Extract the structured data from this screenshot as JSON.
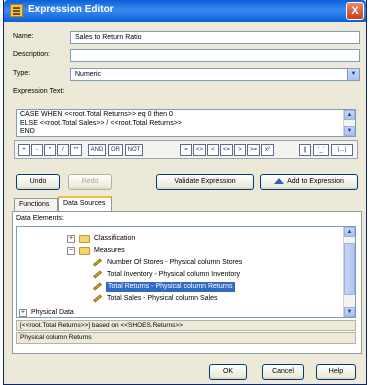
{
  "window": {
    "title": "Expression Editor",
    "close_glyph": "X"
  },
  "form": {
    "name_label": "Name:",
    "name_value": "Sales to Return Ratio",
    "description_label": "Description:",
    "description_value": "",
    "type_label": "Type:",
    "type_value": "Numeric",
    "expression_label": "Expression Text:"
  },
  "expression": {
    "lines": [
      "CASE WHEN <<root.Total Returns>> eq 0 then 0",
      "ELSE <<root.Total Sales>> / <<root.Total Returns>>",
      "END"
    ]
  },
  "operators": [
    {
      "label": "+"
    },
    {
      "label": "-"
    },
    {
      "label": "*"
    },
    {
      "label": "/"
    },
    {
      "label": "**"
    },
    {
      "label": "AND"
    },
    {
      "label": "OR"
    },
    {
      "label": "NOT"
    },
    {
      "label": "="
    },
    {
      "label": "<>"
    },
    {
      "label": "<"
    },
    {
      "label": "<="
    },
    {
      "label": ">"
    },
    {
      "label": ">="
    },
    {
      "label": "x²"
    },
    {
      "label": "||"
    },
    {
      "label": "'_'"
    },
    {
      "label": "(...)"
    }
  ],
  "actions": {
    "undo": "Undo",
    "redo": "Redo",
    "validate": "Validate Expression",
    "add": "Add to Expression"
  },
  "tabs": [
    {
      "label": "Functions"
    },
    {
      "label": "Data Sources"
    }
  ],
  "data_elements_label": "Data Elements:",
  "tree": {
    "classification": "Classification",
    "measures": "Measures",
    "items": [
      "Number Of Stores - Physical column Stores",
      "Total Inventory - Physical column Inventory",
      "Total Returns - Physical column Returns",
      "Total Sales - Physical column Sales"
    ],
    "physical_data": "Physical Data"
  },
  "info_text": "[<<root.Total Returns>>] based on <<SHOES.Returns>>",
  "description_text": "Physical column Returns",
  "footer": {
    "ok": "OK",
    "cancel": "Cancel",
    "help": "Help"
  }
}
